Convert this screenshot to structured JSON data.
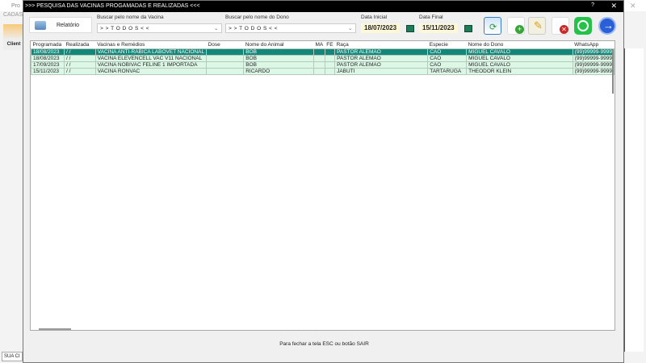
{
  "background": {
    "title": "Pro",
    "menu": "CADAS",
    "clients": "Client",
    "status": "SUA CI"
  },
  "dialog": {
    "title": ">>>  PESQUISA DAS VACINAS PROGAMADAS E REALIZADAS  <<<",
    "help": "?",
    "close": "✕"
  },
  "toolbar": {
    "report": "Relatório",
    "vaccine_label": "Buscar pelo nome da Vacina",
    "vaccine_value": "> > T O D O S < <",
    "owner_label": "Buscar pelo nome do Dono",
    "owner_value": "> > T O D O S < <",
    "start_label": "Data Inicial",
    "start_value": "18/07/2023",
    "end_label": "Data Final",
    "end_value": "15/11/2023"
  },
  "table": {
    "headers": [
      "Programada",
      "Realizada",
      "Vacinas e Remédios",
      "Dose",
      "Nome do Animal",
      "MA",
      "FE",
      "Raça",
      "Especie",
      "Nome do Dono",
      "WhatsApp"
    ],
    "rows": [
      [
        "18/08/2023",
        "  /  /",
        "VACINA ANTI-RABICA LABOVET NACIONAL",
        "",
        "BOB",
        "",
        "",
        "PASTOR ALEMÃO",
        "CÃO",
        "MIGUEL CAVALO",
        "(99)99999-9999"
      ],
      [
        "18/08/2023",
        "  /  /",
        "VACINA ELEVENCELL VAC V11 NACIONAL",
        "",
        "BOB",
        "",
        "",
        "PASTOR ALEMÃO",
        "CÃO",
        "MIGUEL CAVALO",
        "(99)99999-9999"
      ],
      [
        "17/09/2023",
        "  /  /",
        "VACINA NOBIVAC FELINE 1 IMPORTADA",
        "",
        "BOB",
        "",
        "",
        "PASTOR ALEMÃO",
        "CÃO",
        "MIGUEL CAVALO",
        "(99)99999-9999"
      ],
      [
        "15/11/2023",
        "  /  /",
        "VACINA RONVAC",
        "",
        "RICARDO",
        "",
        "",
        "JABUTI",
        "TARTARUGA",
        "THEODOR KLEIN",
        "(99)99999-9999"
      ]
    ]
  },
  "footer": "Para fechar a tela ESC ou botão SAIR"
}
